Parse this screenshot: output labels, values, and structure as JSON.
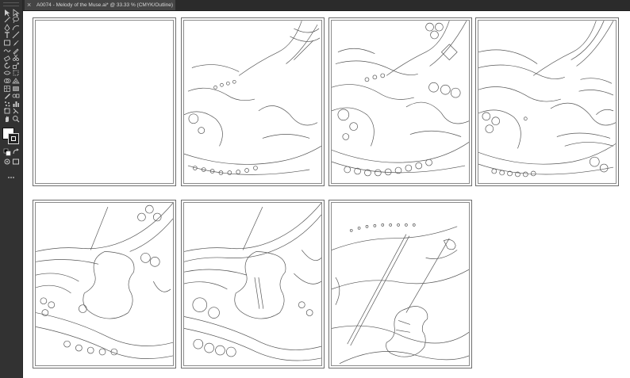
{
  "document": {
    "tab_title": "A0074 - Melody of the Muse.ai* @ 33.33 % (CMYK/Outline)",
    "close_glyph": "×"
  },
  "tools": [
    {
      "name": "selection-tool-icon"
    },
    {
      "name": "direct-selection-tool-icon"
    },
    {
      "name": "magic-wand-tool-icon"
    },
    {
      "name": "lasso-tool-icon"
    },
    {
      "name": "pen-tool-icon"
    },
    {
      "name": "curvature-tool-icon"
    },
    {
      "name": "type-tool-icon"
    },
    {
      "name": "line-segment-tool-icon"
    },
    {
      "name": "rectangle-tool-icon"
    },
    {
      "name": "paintbrush-tool-icon"
    },
    {
      "name": "shaper-tool-icon"
    },
    {
      "name": "pencil-tool-icon"
    },
    {
      "name": "eraser-tool-icon"
    },
    {
      "name": "scissors-tool-icon"
    },
    {
      "name": "rotate-tool-icon"
    },
    {
      "name": "scale-tool-icon"
    },
    {
      "name": "width-tool-icon"
    },
    {
      "name": "free-transform-tool-icon"
    },
    {
      "name": "shape-builder-tool-icon"
    },
    {
      "name": "perspective-grid-tool-icon"
    },
    {
      "name": "mesh-tool-icon"
    },
    {
      "name": "gradient-tool-icon"
    },
    {
      "name": "eyedropper-tool-icon"
    },
    {
      "name": "blend-tool-icon"
    },
    {
      "name": "symbol-sprayer-tool-icon"
    },
    {
      "name": "column-graph-tool-icon"
    },
    {
      "name": "artboard-tool-icon"
    },
    {
      "name": "slice-tool-icon"
    },
    {
      "name": "hand-tool-icon"
    },
    {
      "name": "zoom-tool-icon"
    }
  ],
  "colors": {
    "toolbar_bg": "#323232",
    "tabbar_bg": "#2b2b2b",
    "tab_active_bg": "#454545",
    "canvas_bg": "#ffffff",
    "artboard_stroke": "#6d6d6d",
    "art_line": "#555555"
  },
  "artboards": [
    {
      "name": "artboard-1",
      "stage": "blank"
    },
    {
      "name": "artboard-2",
      "stage": "pattern-partial"
    },
    {
      "name": "artboard-3",
      "stage": "pattern-detailed"
    },
    {
      "name": "artboard-4",
      "stage": "pattern-dense"
    },
    {
      "name": "artboard-5",
      "stage": "pattern-full"
    },
    {
      "name": "artboard-6",
      "stage": "pattern-waves"
    },
    {
      "name": "artboard-7",
      "stage": "violin-outline"
    }
  ]
}
